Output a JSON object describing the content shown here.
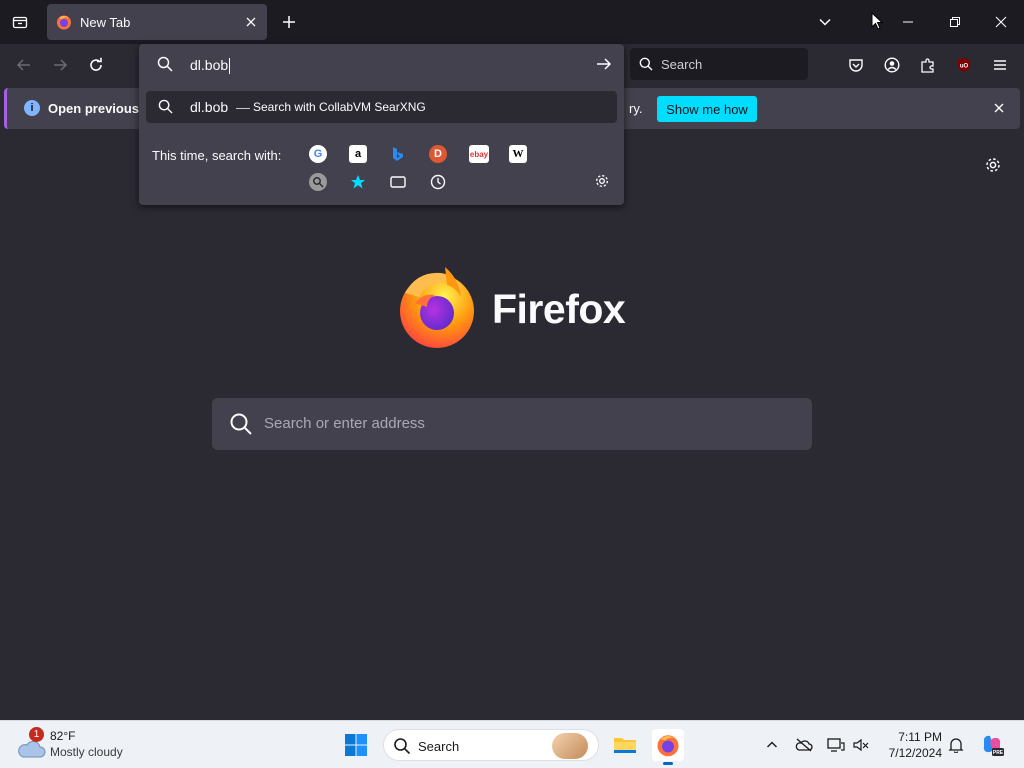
{
  "browser": {
    "tab": {
      "title": "New Tab"
    },
    "toolbar_search": {
      "label": "Search"
    },
    "urlbar": {
      "typed_text": "dl.bob",
      "suggestion": {
        "query": "dl.bob",
        "separator": "—",
        "engine_text": "Search with CollabVM SearXNG"
      },
      "oneoff_label": "This time, search with:",
      "oneoff_engines": [
        "google",
        "amazon",
        "bing",
        "duckduckgo",
        "ebay",
        "wikipedia",
        "searxng",
        "bookmarks",
        "tabs",
        "history"
      ]
    },
    "notification": {
      "message": "Open previous tab",
      "message_tail": "ry.",
      "action": "Show me how"
    }
  },
  "newtab": {
    "wordmark": "Firefox",
    "search_placeholder": "Search or enter address"
  },
  "taskbar": {
    "weather": {
      "temp": "82°F",
      "condition": "Mostly cloudy",
      "badge": "1"
    },
    "search_label": "Search",
    "clock": {
      "time": "7:11 PM",
      "date": "7/12/2024"
    }
  },
  "colors": {
    "accent": "#00ddff",
    "tab_bg": "#42414d",
    "chrome_bg": "#1c1b22",
    "page_bg": "#2b2a33"
  }
}
